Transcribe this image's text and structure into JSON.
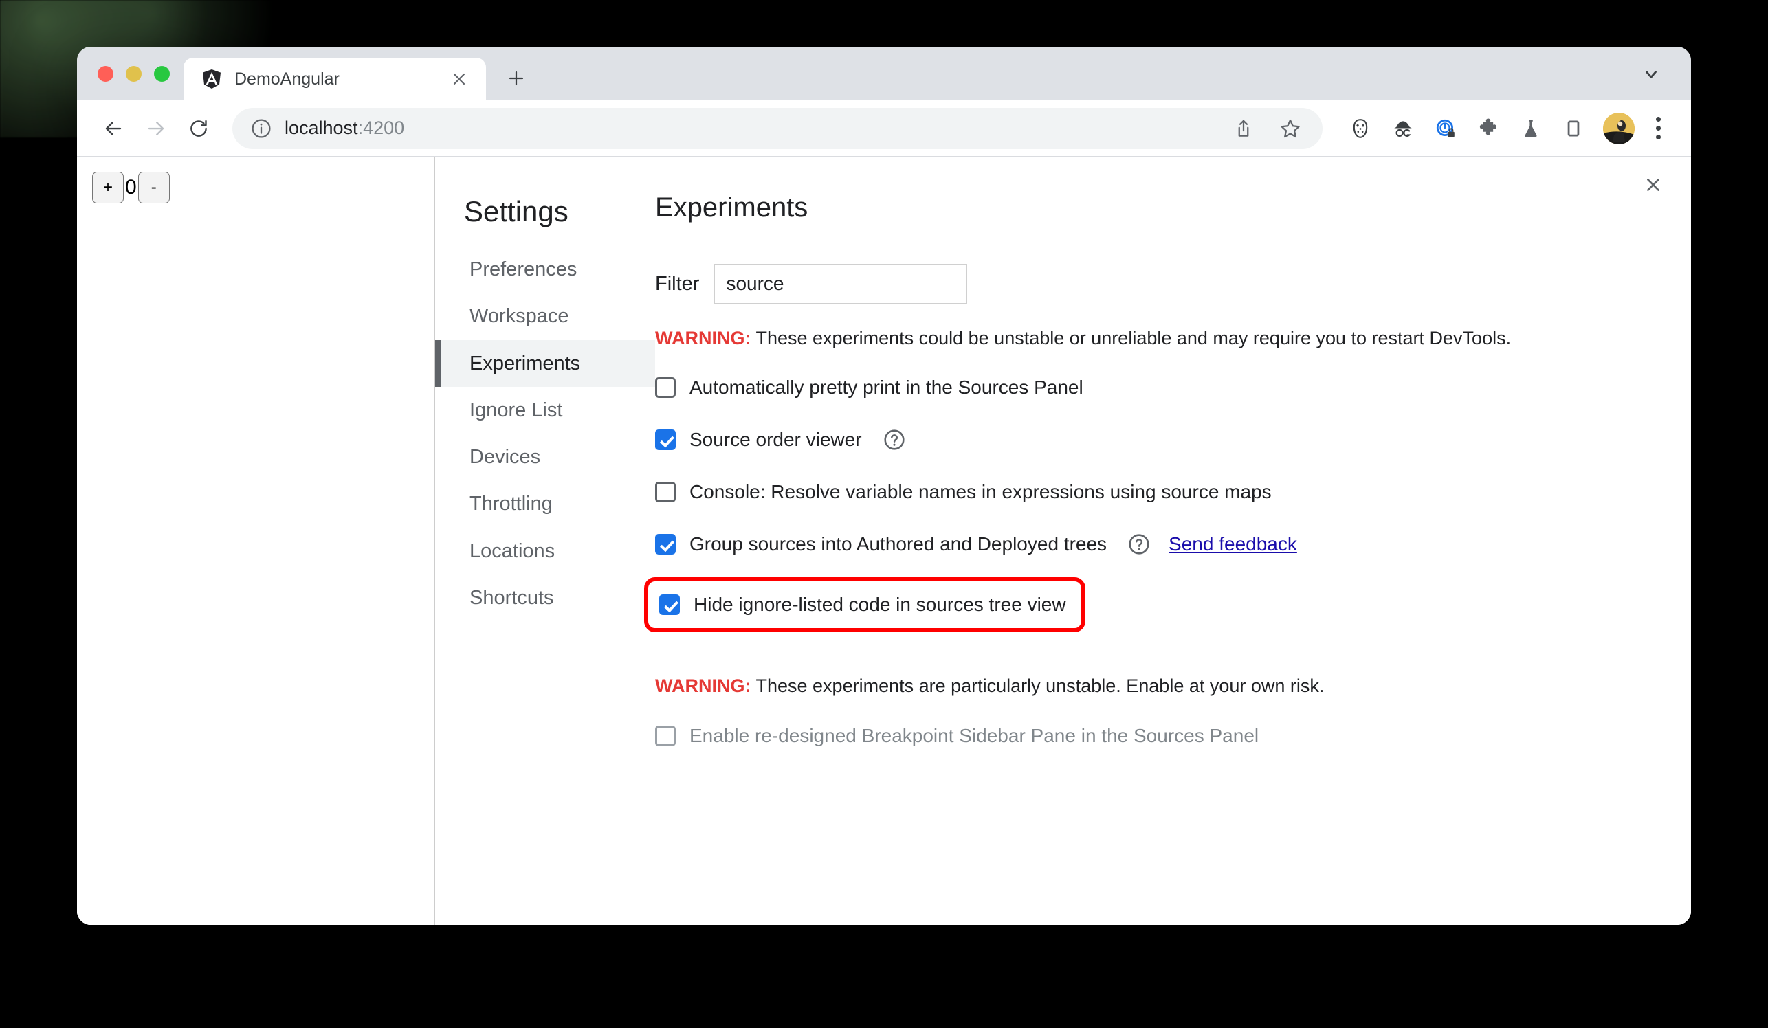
{
  "browser": {
    "tab": {
      "title": "DemoAngular",
      "favicon_name": "angular-logo-icon",
      "close_icon": "close-icon"
    },
    "new_tab_label": "+",
    "window_chevron_icon": "chevron-down-icon",
    "toolbar": {
      "back_icon": "back-arrow-icon",
      "forward_icon": "forward-arrow-icon",
      "reload_icon": "reload-icon",
      "site_info_icon": "info-circle-icon",
      "url_host": "localhost",
      "url_port": ":4200",
      "share_icon": "share-icon",
      "bookmark_icon": "star-icon",
      "extensions": [
        {
          "name": "hockey-mask-extension-icon"
        },
        {
          "name": "og-hat-extension-icon"
        },
        {
          "name": "lock-meter-extension-icon"
        },
        {
          "name": "puzzle-piece-extensions-icon"
        },
        {
          "name": "flask-experiments-icon"
        },
        {
          "name": "side-panel-icon"
        }
      ],
      "avatar_name": "profile-avatar",
      "menu_icon": "three-dot-menu-icon"
    }
  },
  "page": {
    "increment_label": "+",
    "counter_value": "0",
    "decrement_label": "-"
  },
  "devtools": {
    "close_icon": "close-icon",
    "settings_title": "Settings",
    "nav_items": [
      {
        "label": "Preferences",
        "selected": false
      },
      {
        "label": "Workspace",
        "selected": false
      },
      {
        "label": "Experiments",
        "selected": true
      },
      {
        "label": "Ignore List",
        "selected": false
      },
      {
        "label": "Devices",
        "selected": false
      },
      {
        "label": "Throttling",
        "selected": false
      },
      {
        "label": "Locations",
        "selected": false
      },
      {
        "label": "Shortcuts",
        "selected": false
      }
    ],
    "panel_title": "Experiments",
    "filter": {
      "label": "Filter",
      "value": "source",
      "placeholder": ""
    },
    "warning_primary": {
      "prefix": "WARNING:",
      "text": " These experiments could be unstable or unreliable and may require you to restart DevTools."
    },
    "experiments": [
      {
        "label": "Automatically pretty print in the Sources Panel",
        "checked": false,
        "disabled": false,
        "help": false,
        "feedback": null,
        "highlighted": false
      },
      {
        "label": "Source order viewer",
        "checked": true,
        "disabled": false,
        "help": true,
        "feedback": null,
        "highlighted": false
      },
      {
        "label": "Console: Resolve variable names in expressions using source maps",
        "checked": false,
        "disabled": false,
        "help": false,
        "feedback": null,
        "highlighted": false
      },
      {
        "label": "Group sources into Authored and Deployed trees",
        "checked": true,
        "disabled": false,
        "help": true,
        "feedback": "Send feedback",
        "highlighted": false
      },
      {
        "label": "Hide ignore-listed code in sources tree view",
        "checked": true,
        "disabled": false,
        "help": false,
        "feedback": null,
        "highlighted": true
      }
    ],
    "warning_secondary": {
      "prefix": "WARNING:",
      "text": " These experiments are particularly unstable. Enable at your own risk."
    },
    "unstable_experiments": [
      {
        "label": "Enable re-designed Breakpoint Sidebar Pane in the Sources Panel",
        "checked": false,
        "disabled": true,
        "help": false,
        "feedback": null,
        "highlighted": false
      }
    ]
  },
  "colors": {
    "accent_blue": "#1a73e8",
    "warning_red": "#e53935",
    "highlight_red": "#ff0000",
    "link_blue": "#1a0dab",
    "tabstrip": "#dee1e6",
    "selected_nav_bg": "#f1f3f4"
  }
}
